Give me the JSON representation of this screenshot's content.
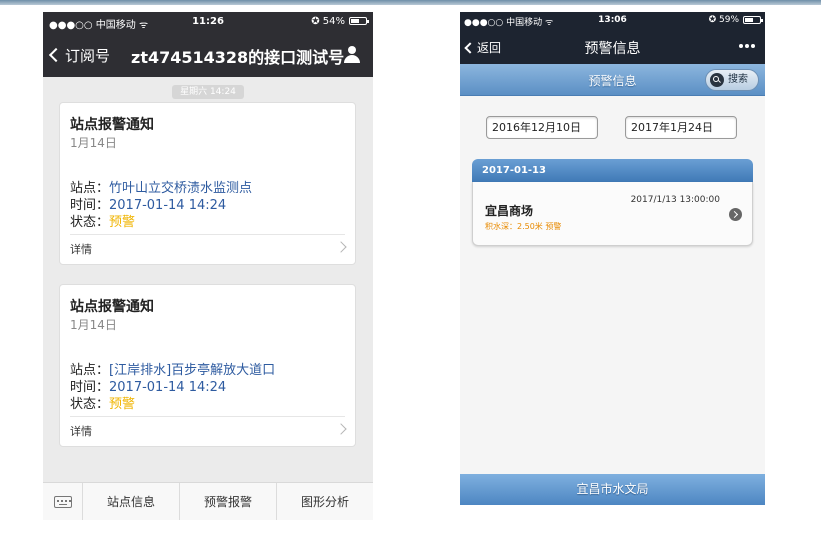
{
  "left": {
    "status": {
      "carrier": "●●●○○ 中国移动 ᯤ",
      "time": "11:26",
      "battery": "✪ 54%",
      "battery_level": 0.54
    },
    "nav": {
      "back_label": "订阅号",
      "title": "zt474514328的接口测试号"
    },
    "timestamp": "星期六 14:24",
    "cards": [
      {
        "title": "站点报警通知",
        "date": "1月14日",
        "site_label": "站点：",
        "site_value": "竹叶山立交桥渍水监测点",
        "time_label": "时间：",
        "time_value": "2017-01-14 14:24",
        "state_label": "状态：",
        "state_value": "预警",
        "detail_label": "详情"
      },
      {
        "title": "站点报警通知",
        "date": "1月14日",
        "site_label": "站点：",
        "site_value": "[江岸排水]百步亭解放大道口",
        "time_label": "时间：",
        "time_value": "2017-01-14 14:24",
        "state_label": "状态：",
        "state_value": "预警",
        "detail_label": "详情"
      }
    ],
    "tabs": [
      "站点信息",
      "预警报警",
      "图形分析"
    ]
  },
  "right": {
    "status": {
      "carrier": "●●●○○ 中国移动 ᯤ",
      "time": "13:06",
      "battery": "✪ 59%",
      "battery_level": 0.59
    },
    "nav": {
      "back_label": "返回",
      "title": "预警信息"
    },
    "bar_title": "预警信息",
    "search_label": "搜索",
    "start_date": "2016年12月10日",
    "end_date": "2017年1月24日",
    "group_date": "2017-01-13",
    "item": {
      "name": "宜昌商场",
      "time": "2017/1/13 13:00:00",
      "depth": "积水深：2.50米 预警"
    },
    "footer": "宜昌市水文局"
  },
  "colors": {
    "wechat_dark": "#2e2e33",
    "link_blue": "#2e5ba0",
    "warning_yellow": "#f0b400",
    "jqm_blue": "#5b8fc4",
    "depth_orange": "#e88a00"
  }
}
